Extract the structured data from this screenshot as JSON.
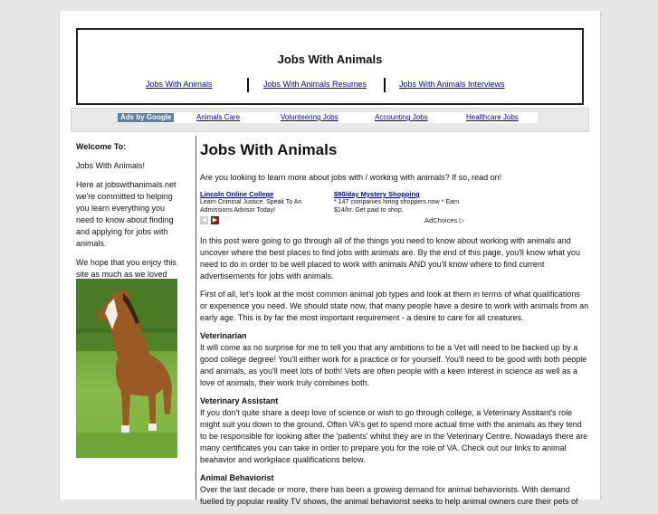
{
  "site": {
    "title": "Jobs With Animals",
    "nav": [
      "Jobs With Animals",
      "Jobs With Animals Resumes",
      "Jobs With Animals Interviews"
    ]
  },
  "adsbar": {
    "label": "Ads by Google",
    "links": [
      "Animals Care",
      "Volunteering Jobs",
      "Accounting Jobs",
      "Healthcare Jobs"
    ]
  },
  "sidebar": {
    "welcome_heading": "Welcome To:",
    "welcome_sub": "Jobs With Animals!",
    "intro": "Here at jobswithanimals.net we're committed to helping you learn everything you need to know about finding and applying for jobs with animals.",
    "hope": "We hope that you enjoy this site as much as we loved making it!"
  },
  "main": {
    "title": "Jobs With Animals",
    "lead": "Are you looking to learn more about jobs with / working with animals? If so, read on!",
    "ads": [
      {
        "title": "Lincoln Online College",
        "text": "Learn Criminal Justice. Speak To An Admissions Advisor Today!"
      },
      {
        "title": "$90/day Mystery Shopping",
        "text": "* 147 companies hiring shoppers now * Earn $14/hr. Get paid to shop."
      }
    ],
    "adchoices": "AdChoices",
    "p1": "In this post were going to go through all of the things you need to know about working with animals and uncover where the best places to find jobs with animals are. By the end of this page, you'll know what you need to do in order to be well placed to work with animals AND you'll know where to find current advertisements for jobs with animals.",
    "p2": "First of all, let's look at the most common animal job types and look at them in terms of what qualifications or experience you need. We should state now, that many people have a desire to work with animals from an early age. This is by far the most important requirement - a desire to care for all creatures.",
    "h_vet": "Veterinarian",
    "p_vet": "It will come as no surprise for me to tell you that any ambitions to be a Vet will need to be backed up by a good college degree! You'll either work for a practice or for yourself. You'll need to be good with both people and animals, as you'll meet lots of both! Vets are often people with a keen interest in science as well as a love of animals, their work truly combines both.",
    "h_va": "Veterinary Assistant",
    "p_va": "If you don't quite share a deep love of science or wish to go through college, a Veterinary Assitant's role might suit you down to the ground. Often VA's get to spend more actual time with the animals as they tend to be responsible for looking after the 'patients' whilst they are in the Veterinary Centre. Nowadays there are many certificates you can take in order to prepare you for the role of VA. Check out our links to animal beahavior and workplace qualifications below.",
    "h_ab": "Animal Behaviorist",
    "p_ab": "Over the last decade or more, there has been a growing demand for animal behaviorists. With demand fuelled by popular reality TV shows, the animal behaviorist seeks to help animal owners cure their pets of"
  }
}
